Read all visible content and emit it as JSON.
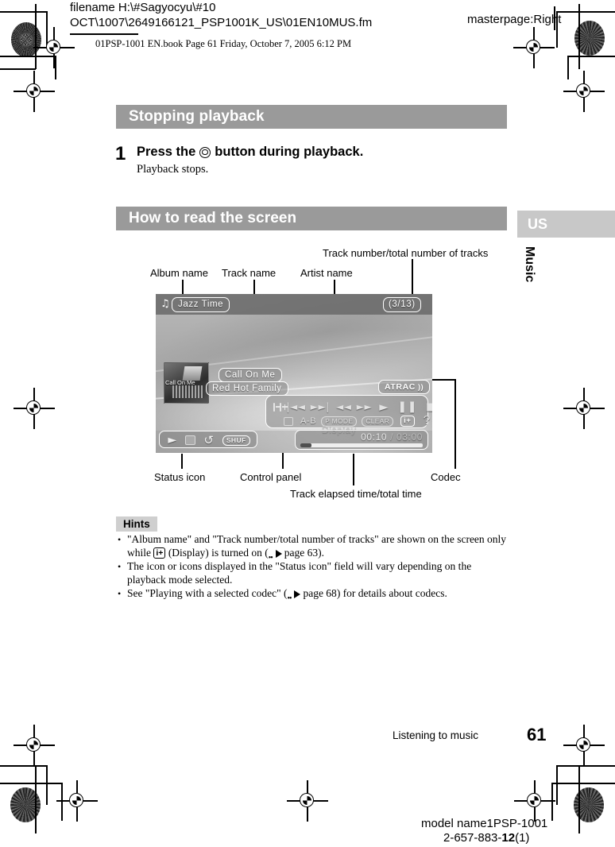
{
  "slug": {
    "line1": "filename H:\\#Sagyocyu\\#10",
    "line2": "OCT\\1007\\2649166121_PSP1001K_US\\01EN10MUS.fm",
    "masterpage": "masterpage:Right",
    "bookline": "01PSP-1001 EN.book  Page 61  Friday, October 7, 2005  6:12 PM"
  },
  "sections": {
    "stopping_playback": "Stopping playback",
    "how_to_read": "How to read the screen"
  },
  "step": {
    "number": "1",
    "title_before": "Press the",
    "title_after": "button during playback.",
    "description": "Playback stops."
  },
  "side_tab": {
    "region": "US",
    "chapter": "Music"
  },
  "figure": {
    "callouts": {
      "album_name": "Album name",
      "track_name": "Track name",
      "artist_name": "Artist name",
      "track_number": "Track number/total number of tracks",
      "status_icon": "Status icon",
      "control_panel": "Control panel",
      "elapsed_time": "Track elapsed time/total time",
      "codec": "Codec"
    },
    "screen": {
      "note_icon": "♫",
      "album_name": "Jazz Time",
      "track_number": "(3/13)",
      "track_name": "Call On Me",
      "artist_name": "Red Hot Family",
      "codec": "ATRAC",
      "codec_wave_icon": "))",
      "album_art_caption": "Call On Me",
      "display_label": "Display",
      "elapsed_time": "00:10",
      "time_separator": " / ",
      "total_time": "03:00",
      "control_panel": {
        "row1": [
          "zoom-out",
          "zoom-in",
          "|◄◄",
          "►►|",
          "◄◄",
          "►►",
          "►",
          "‖",
          "■"
        ],
        "row2_square": "square-icon",
        "row2_ab": "A-B",
        "row2_pmode": "P MODE",
        "row2_clear": "CLEAR",
        "row2_info": "i+",
        "row2_help": "?"
      },
      "status": {
        "play": "►",
        "repeat_one": "repeat-icon",
        "repeat_all": "loop-icon",
        "shuffle": "SHUF"
      }
    }
  },
  "hints": {
    "heading": "Hints",
    "items": [
      {
        "part1": "\"Album name\" and \"Track number/total number of tracks\" are shown on the screen only while",
        "icon": "i+",
        "part2": "(Display) is turned on (",
        "page_ref": "page 63",
        "part3": ")."
      },
      {
        "part1": "The icon or icons displayed in the \"Status icon\" field will vary depending on the playback mode selected.",
        "icon": "",
        "part2": "",
        "page_ref": "",
        "part3": ""
      },
      {
        "part1": "See \"Playing with a selected codec\" (",
        "icon": "",
        "part2": "",
        "page_ref": "page 68",
        "part3": ") for details about codecs."
      }
    ]
  },
  "footer": {
    "running_head": "Listening to music",
    "page_number": "61",
    "model_name": "model name1PSP-1001",
    "doc_number_prefix": "2-657-883-",
    "doc_number_bold": "12",
    "doc_number_suffix": "(1)"
  },
  "colors": {
    "section_bar": "#9a9a9a",
    "tab_bar": "#c8c8c8",
    "hints_bg": "#cfcfcf",
    "screen_dark": "#696969"
  }
}
